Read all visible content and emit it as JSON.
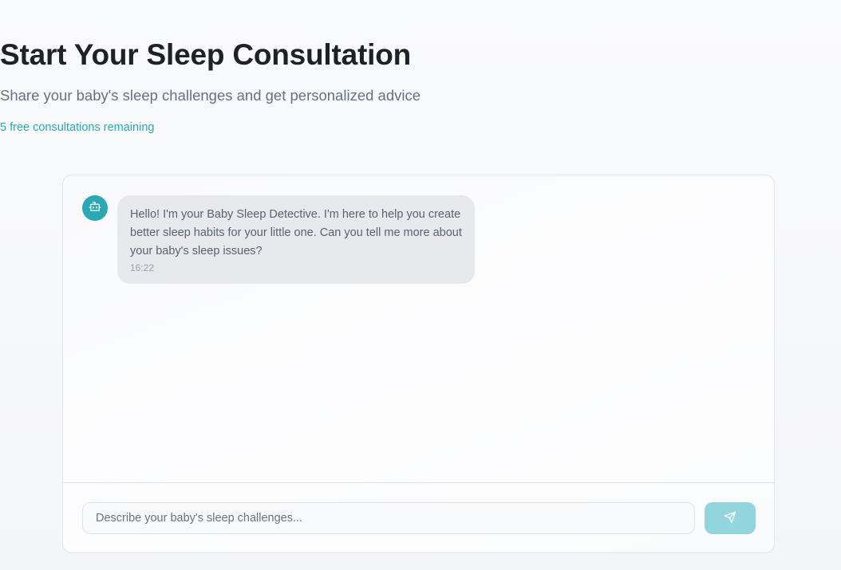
{
  "header": {
    "title": "Start Your Sleep Consultation",
    "subtitle": "Share your baby's sleep challenges and get personalized advice",
    "remaining": "5 free consultations remaining"
  },
  "chat": {
    "messages": [
      {
        "sender_icon": "bot-icon",
        "text": "Hello! I'm your Baby Sleep Detective. I'm here to help you create better sleep habits for your little one. Can you tell me more about your baby's sleep issues?",
        "time": "16:22"
      }
    ]
  },
  "composer": {
    "placeholder": "Describe your baby's sleep challenges...",
    "value": "",
    "send_icon": "send-icon"
  },
  "colors": {
    "accent": "#2aa9b5",
    "send_button": "#93d5dc",
    "bubble": "#e8e9ed"
  }
}
